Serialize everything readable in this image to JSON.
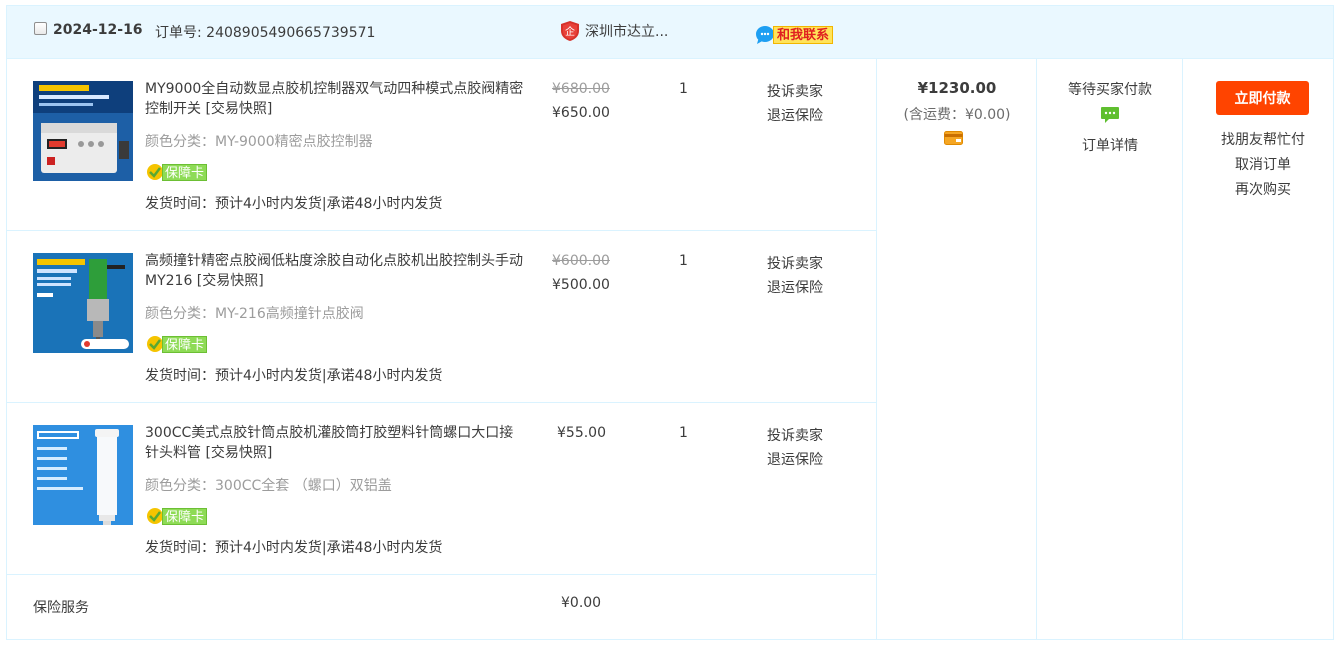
{
  "header": {
    "date": "2024-12-16",
    "order_no_label": "订单号:",
    "order_no": "2408905490665739571",
    "shop_name": "深圳市达立...",
    "contact_label": "和我联系"
  },
  "items": [
    {
      "title": "MY9000全自动数显点胶机控制器双气动四种模式点胶阀精密控制开关 [交易快照]",
      "spec": "颜色分类：MY-9000精密点胶控制器",
      "badge": "保障卡",
      "ship": "发货时间：预计4小时内发货|承诺48小时内发货",
      "price_original": "¥680.00",
      "price_now": "¥650.00",
      "qty": "1",
      "link_complain": "投诉卖家",
      "link_insurance": "退运保险"
    },
    {
      "title": "高频撞针精密点胶阀低粘度涂胶自动化点胶机出胶控制头手动MY216 [交易快照]",
      "spec": "颜色分类：MY-216高频撞针点胶阀",
      "badge": "保障卡",
      "ship": "发货时间：预计4小时内发货|承诺48小时内发货",
      "price_original": "¥600.00",
      "price_now": "¥500.00",
      "qty": "1",
      "link_complain": "投诉卖家",
      "link_insurance": "退运保险"
    },
    {
      "title": "300CC美式点胶针筒点胶机灌胶筒打胶塑料针筒螺口大口接针头料管 [交易快照]",
      "spec": "颜色分类：300CC全套 （螺口）双铝盖",
      "badge": "保障卡",
      "ship": "发货时间：预计4小时内发货|承诺48小时内发货",
      "price": "¥55.00",
      "qty": "1",
      "link_complain": "投诉卖家",
      "link_insurance": "退运保险"
    }
  ],
  "insurance": {
    "label": "保险服务",
    "price": "¥0.00"
  },
  "total": {
    "amount": "¥1230.00",
    "shipping": "(含运费：¥0.00)"
  },
  "status": {
    "text": "等待买家付款",
    "detail_link": "订单详情"
  },
  "ops": {
    "pay_button": "立即付款",
    "friend_pay": "找朋友帮忙付",
    "cancel": "取消订单",
    "rebuy": "再次购买"
  },
  "colors": {
    "header_bg": "#eaf8ff",
    "border": "#daf3ff",
    "pay_button": "#ff4400",
    "text": "#3c3c3c",
    "muted": "#9c9c9c"
  }
}
